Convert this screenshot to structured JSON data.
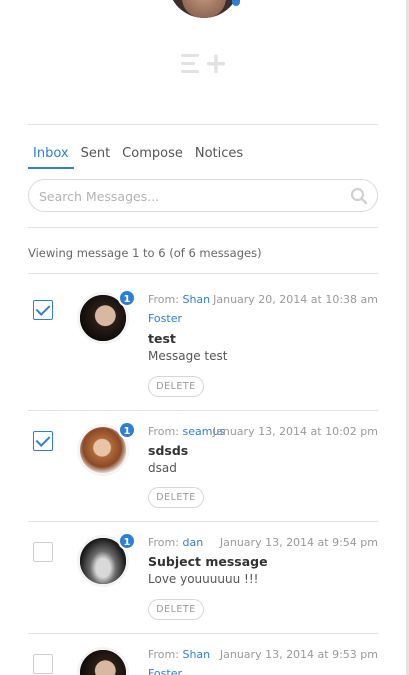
{
  "tabs": [
    {
      "label": "Inbox",
      "active": true
    },
    {
      "label": "Sent",
      "active": false
    },
    {
      "label": "Compose",
      "active": false
    },
    {
      "label": "Notices",
      "active": false
    }
  ],
  "search": {
    "placeholder": "Search Messages...",
    "value": ""
  },
  "viewing_text": "Viewing message 1 to 6 (of 6 messages)",
  "messages": [
    {
      "checked": true,
      "unread_count": "1",
      "from_label": "From:",
      "from_name": "Shan",
      "from_name_cont": "Foster",
      "date": "January 20, 2014 at 10:38 am",
      "subject": "test",
      "excerpt": "Message test",
      "delete_label": "DELETE"
    },
    {
      "checked": true,
      "unread_count": "1",
      "from_label": "From:",
      "from_name": "seamus",
      "from_name_cont": "",
      "date": "January 13, 2014 at 10:02 pm",
      "subject": "sdsds",
      "excerpt": "dsad",
      "delete_label": "DELETE"
    },
    {
      "checked": false,
      "unread_count": "1",
      "from_label": "From:",
      "from_name": "dan",
      "from_name_cont": "",
      "date": "January 13, 2014 at 9:54 pm",
      "subject": "Subject message",
      "excerpt": "Love youuuuuu !!!",
      "delete_label": "DELETE"
    },
    {
      "checked": false,
      "unread_count": "",
      "from_label": "From:",
      "from_name": "Shan",
      "from_name_cont": "Foster",
      "date": "January 13, 2014 at 9:53 pm",
      "subject": "",
      "excerpt": "",
      "delete_label": ""
    }
  ],
  "colors": {
    "accent": "#2d7fd3",
    "divider": "#e3e3e3",
    "muted_text": "#999999"
  },
  "icons": {
    "compose": "compose-add-icon",
    "search": "search-icon"
  }
}
